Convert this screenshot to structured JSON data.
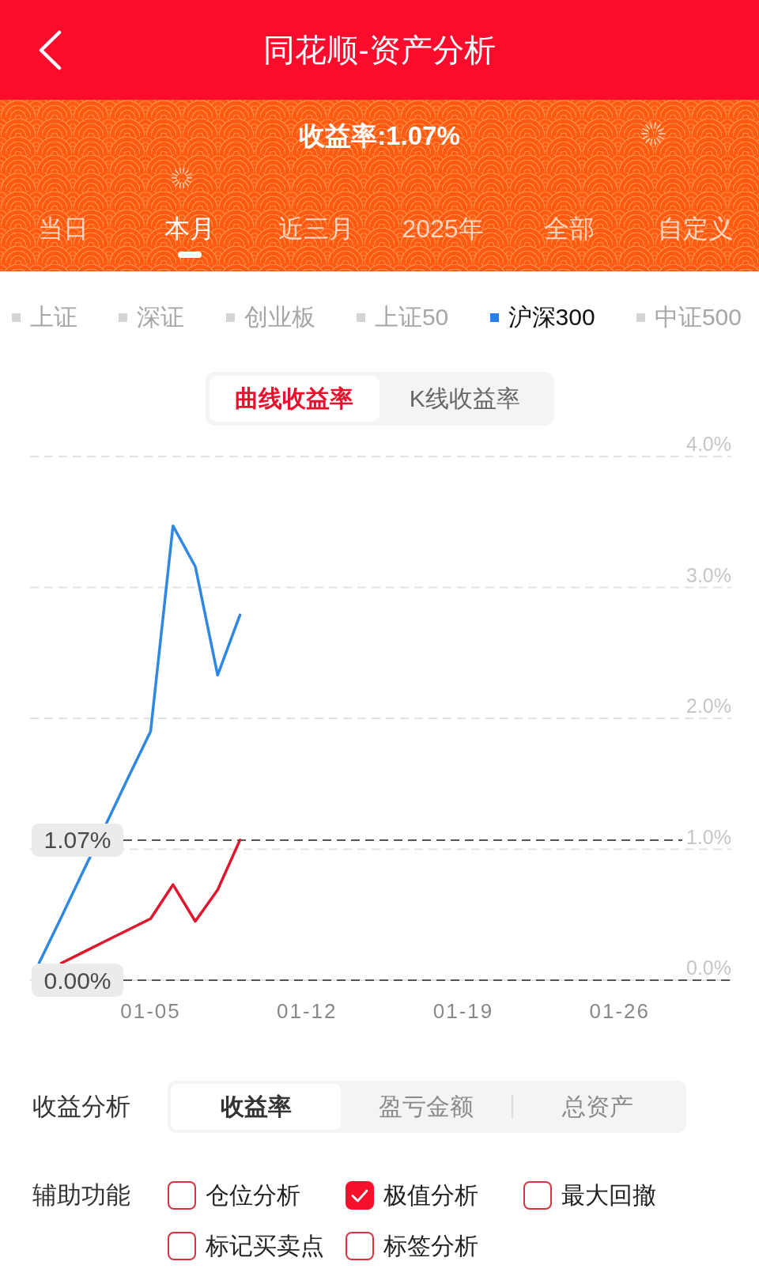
{
  "header": {
    "title": "同花顺-资产分析"
  },
  "summary": {
    "text": "收益率:1.07%"
  },
  "period_tabs": [
    {
      "label": "当日",
      "selected": false
    },
    {
      "label": "本月",
      "selected": true
    },
    {
      "label": "近三月",
      "selected": false
    },
    {
      "label": "2025年",
      "selected": false
    },
    {
      "label": "全部",
      "selected": false
    },
    {
      "label": "自定义",
      "selected": false
    }
  ],
  "benchmarks": [
    {
      "label": "上证",
      "selected": false
    },
    {
      "label": "深证",
      "selected": false
    },
    {
      "label": "创业板",
      "selected": false
    },
    {
      "label": "上证50",
      "selected": false
    },
    {
      "label": "沪深300",
      "selected": true
    },
    {
      "label": "中证500",
      "selected": false
    }
  ],
  "chart_modes": [
    {
      "label": "曲线收益率",
      "selected": true
    },
    {
      "label": "K线收益率",
      "selected": false
    }
  ],
  "chart": {
    "chart_data": {
      "type": "line",
      "grid": true,
      "categories": [
        null,
        null,
        null,
        null,
        null,
        "01-05",
        null,
        null,
        null,
        null,
        null,
        null,
        "01-12",
        null,
        null,
        null,
        null,
        null,
        null,
        "01-19",
        null,
        null,
        null,
        null,
        null,
        null,
        "01-26",
        null,
        null,
        null,
        null,
        null
      ],
      "ylim": [
        0,
        4
      ],
      "yticks": [
        {
          "value": 0,
          "label": "0.0%"
        },
        {
          "value": 1,
          "label": "1.0%"
        },
        {
          "value": 2,
          "label": "2.0%"
        },
        {
          "value": 3,
          "label": "3.0%"
        },
        {
          "value": 4,
          "label": "4.0%"
        }
      ],
      "series": [
        {
          "color": "#2e88e2",
          "values": [
            0.13,
            0.48,
            0.84,
            1.19,
            1.55,
            1.9,
            3.47,
            3.16,
            2.33,
            2.79,
            null,
            null,
            null,
            null,
            null,
            null,
            null,
            null,
            null,
            null,
            null,
            null,
            null,
            null,
            null,
            null,
            null,
            null,
            null,
            null,
            null,
            null
          ]
        },
        {
          "color": "#e0162d",
          "values": [
            null,
            0.13,
            0.215,
            0.3,
            0.385,
            0.47,
            0.73,
            0.45,
            0.69,
            1.07,
            null,
            null,
            null,
            null,
            null,
            null,
            null,
            null,
            null,
            null,
            null,
            null,
            null,
            null,
            null,
            null,
            null,
            null,
            null,
            null,
            null,
            null
          ]
        }
      ],
      "ref_lines": [
        {
          "axis": "y",
          "value": 1.07,
          "label": "1.07%"
        },
        {
          "axis": "y",
          "value": 0,
          "label": "0.00%"
        }
      ]
    }
  },
  "return_analysis": {
    "label": "收益分析",
    "options": [
      {
        "label": "收益率",
        "selected": true
      },
      {
        "label": "盈亏金额",
        "selected": false
      },
      {
        "label": "总资产",
        "selected": false
      }
    ]
  },
  "assist_tools": {
    "label": "辅助功能",
    "options": [
      {
        "label": "仓位分析",
        "checked": false
      },
      {
        "label": "极值分析",
        "checked": true
      },
      {
        "label": "最大回撤",
        "checked": false
      },
      {
        "label": "标记买卖点",
        "checked": false
      },
      {
        "label": "标签分析",
        "checked": false
      }
    ]
  }
}
